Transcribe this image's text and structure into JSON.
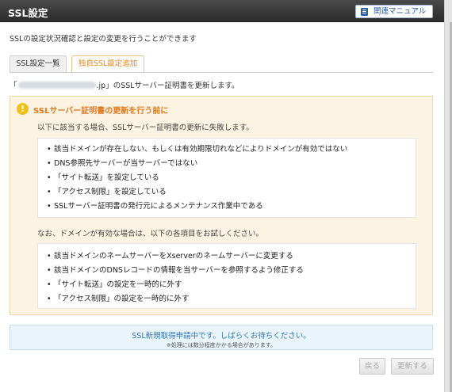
{
  "header": {
    "title": "SSL設定",
    "manual_button": "関連マニュアル",
    "manual_icon": "book-icon"
  },
  "description": "SSLの設定状況確認と設定の変更を行うことができます",
  "tabs": [
    {
      "label": "SSL設定一覧",
      "active": false
    },
    {
      "label": "独自SSL設定追加",
      "active": true
    }
  ],
  "domain_message": {
    "prefix": "「",
    "suffix": ".jp」のSSLサーバー証明書を更新します。"
  },
  "warning": {
    "heading": "SSLサーバー証明書の更新を行う前に",
    "lead": "以下に該当する場合、SSLサーバー証明書の更新に失敗します。",
    "conditions": [
      "該当ドメインが存在しない、もしくは有効期限切れなどによりドメインが有効ではない",
      "DNS参照先サーバーが当サーバーではない",
      "「サイト転送」を設定している",
      "「アクセス制限」を設定している",
      "SSLサーバー証明書の発行元によるメンテナンス作業中である"
    ],
    "note": "なお、ドメインが有効な場合は、以下の各項目をお試しください。",
    "suggestions": [
      "該当ドメインのネームサーバーをXserverのネームサーバーに変更する",
      "該当ドメインのDNSレコードの情報を当サーバーを参照するよう修正する",
      "「サイト転送」の設定を一時的に外す",
      "「アクセス制限」の設定を一時的に外す"
    ]
  },
  "status": {
    "message": "SSL新規取得申請中です。しばらくお待ちください。",
    "sub": "※処理には数分程度かかる場合があります。"
  },
  "buttons": {
    "back": "戻る",
    "update": "更新する"
  },
  "colors": {
    "accent": "#e6871e",
    "info": "#2c76b8",
    "header_bg": "#3a3a3a",
    "warning_bg": "#fcf3e3"
  }
}
